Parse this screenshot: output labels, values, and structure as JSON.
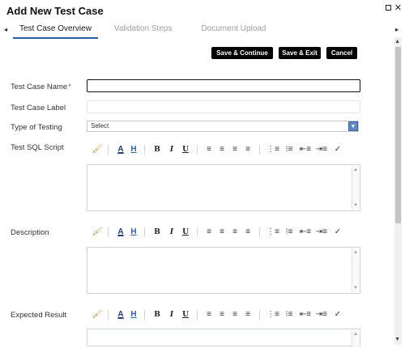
{
  "window": {
    "title": "Add New Test Case",
    "restore_icon": "restore-icon",
    "close_glyph": "✕"
  },
  "tabs": [
    {
      "label": "Test Case Overview",
      "active": true
    },
    {
      "label": "Validation Steps",
      "active": false
    },
    {
      "label": "Document Upload",
      "active": false
    }
  ],
  "tab_nav": {
    "left_glyph": "◂",
    "right_glyph": "▸"
  },
  "actions": {
    "save_continue": "Save & Continue",
    "save_exit": "Save & Exit",
    "cancel": "Cancel"
  },
  "form": {
    "name_label": "Test Case Name",
    "name_required_mark": "*",
    "name_value": "",
    "label_label": "Test Case Label",
    "label_value": "",
    "type_label": "Type of Testing",
    "type_value": "Select",
    "sql_label": "Test SQL Script",
    "description_label": "Description",
    "expected_label": "Expected Result"
  },
  "toolbar": {
    "fill": "🖌",
    "font_color": "A",
    "highlight": "H",
    "bold": "B",
    "italic": "I",
    "underline": "U",
    "align_left": "≡",
    "align_center": "≡",
    "align_right": "≡",
    "justify": "≡",
    "ordered_list": "⋮≡",
    "bullet_list": "⁝≡",
    "outdent": "⇤≡",
    "indent": "⇥≡",
    "clear_format": "✓"
  },
  "colors": {
    "accent": "#1f5fb4",
    "button_bg": "#000000",
    "required": "#e53935",
    "select_arrow": "#5b86c9"
  }
}
